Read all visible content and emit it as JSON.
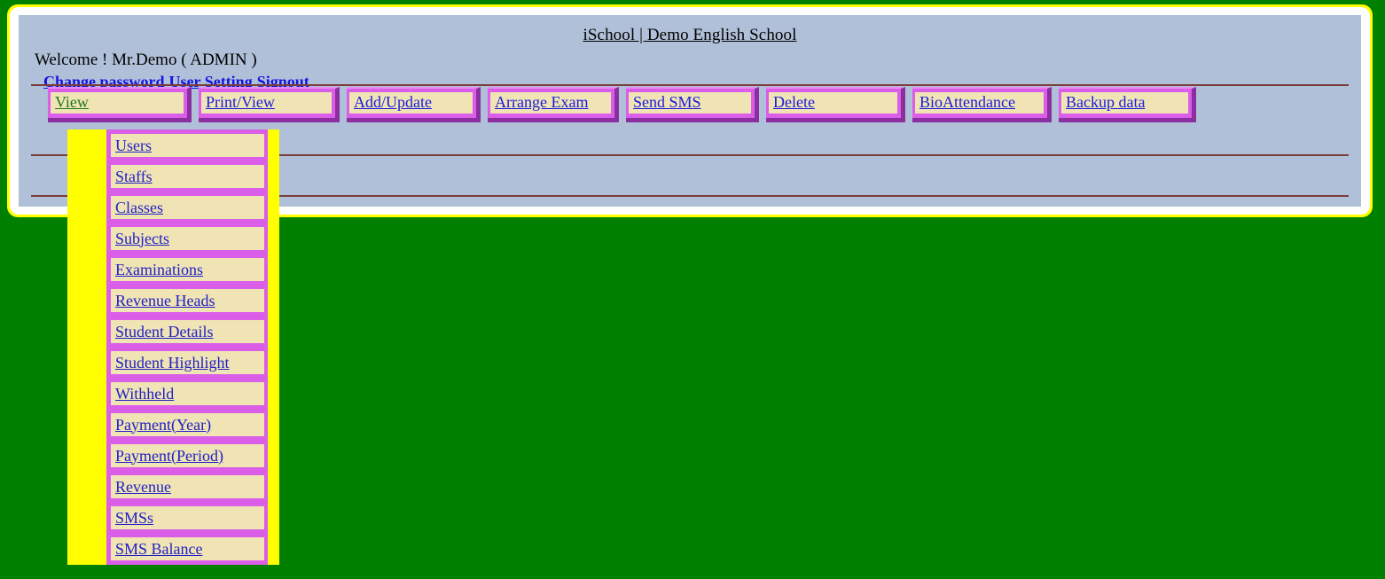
{
  "page": {
    "background_color": "#008000",
    "frame_outer_color": "#ffff00",
    "frame_inner_color": "#ffffff",
    "panel_color": "#b0c0d8",
    "rule_color": "#7a3b3b",
    "accent_purple": "#da5ee8",
    "accent_shadow": "#8b2fa0",
    "tab_face_color": "#f0e4b4",
    "link_color": "#1a1ae0",
    "active_link_color": "#1b7a1b"
  },
  "header": {
    "title": "iSchool | Demo English School",
    "welcome": "Welcome ! Mr.Demo ( ADMIN )",
    "account_links": [
      {
        "label": "Change password"
      },
      {
        "label": "User Setting"
      },
      {
        "label": "Signout"
      }
    ]
  },
  "nav": {
    "tabs": [
      {
        "id": "view",
        "label": "View",
        "active": true
      },
      {
        "id": "printview",
        "label": "Print/View",
        "active": false
      },
      {
        "id": "addupdate",
        "label": "Add/Update",
        "active": false
      },
      {
        "id": "arrangeexam",
        "label": "Arrange Exam",
        "active": false
      },
      {
        "id": "sendsms",
        "label": "Send SMS",
        "active": false
      },
      {
        "id": "delete",
        "label": "Delete",
        "active": false
      },
      {
        "id": "bioattendance",
        "label": "BioAttendance",
        "active": false
      },
      {
        "id": "backupdata",
        "label": "Backup data",
        "active": false
      }
    ]
  },
  "dropdown": {
    "owner_tab": "View",
    "open": true,
    "items": [
      {
        "label": "Users"
      },
      {
        "label": "Staffs"
      },
      {
        "label": "Classes"
      },
      {
        "label": "Subjects"
      },
      {
        "label": "Examinations"
      },
      {
        "label": "Revenue Heads"
      },
      {
        "label": "Student Details"
      },
      {
        "label": "Student Highlight"
      },
      {
        "label": "Withheld"
      },
      {
        "label": "Payment(Year)"
      },
      {
        "label": "Payment(Period)"
      },
      {
        "label": "Revenue"
      },
      {
        "label": "SMSs"
      },
      {
        "label": "SMS Balance"
      }
    ]
  }
}
